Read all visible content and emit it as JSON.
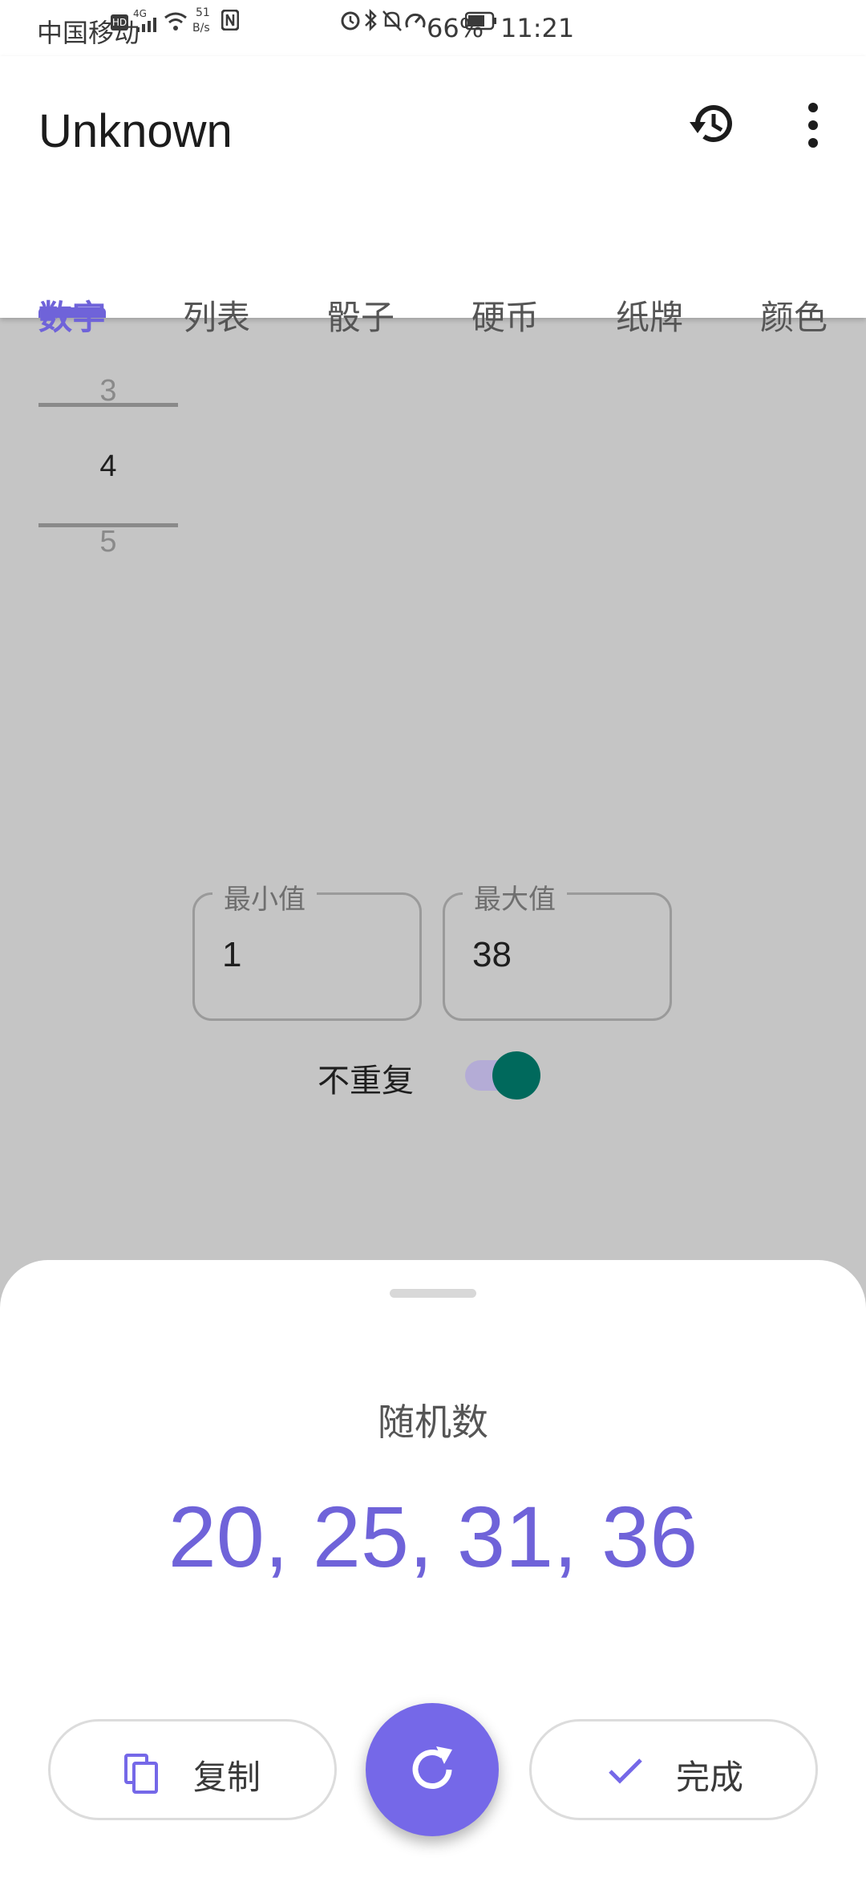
{
  "status_bar": {
    "carrier": "中国移动",
    "hd": "HD",
    "signal": "4G",
    "speed_value": "51",
    "speed_unit": "B/s",
    "battery": "66%",
    "time": "11:21"
  },
  "app_bar": {
    "title": "Unknown"
  },
  "tabs": [
    {
      "label": "数字",
      "active": true
    },
    {
      "label": "列表",
      "active": false
    },
    {
      "label": "骰子",
      "active": false
    },
    {
      "label": "硬币",
      "active": false
    },
    {
      "label": "纸牌",
      "active": false
    },
    {
      "label": "颜色",
      "active": false
    }
  ],
  "picker": {
    "prev": "3",
    "current": "4",
    "next": "5"
  },
  "fields": {
    "min": {
      "label": "最小值",
      "value": "1"
    },
    "max": {
      "label": "最大值",
      "value": "38"
    }
  },
  "no_repeat": {
    "label": "不重复",
    "on": true
  },
  "sheet": {
    "title": "随机数",
    "result": "20, 25, 31, 36",
    "copy_label": "复制",
    "done_label": "完成"
  },
  "colors": {
    "accent": "#6f63d9",
    "fab": "#7568e8",
    "switch_thumb": "#00695c",
    "switch_track": "#b4acd6",
    "scrim_bg": "#c5c5c5"
  }
}
